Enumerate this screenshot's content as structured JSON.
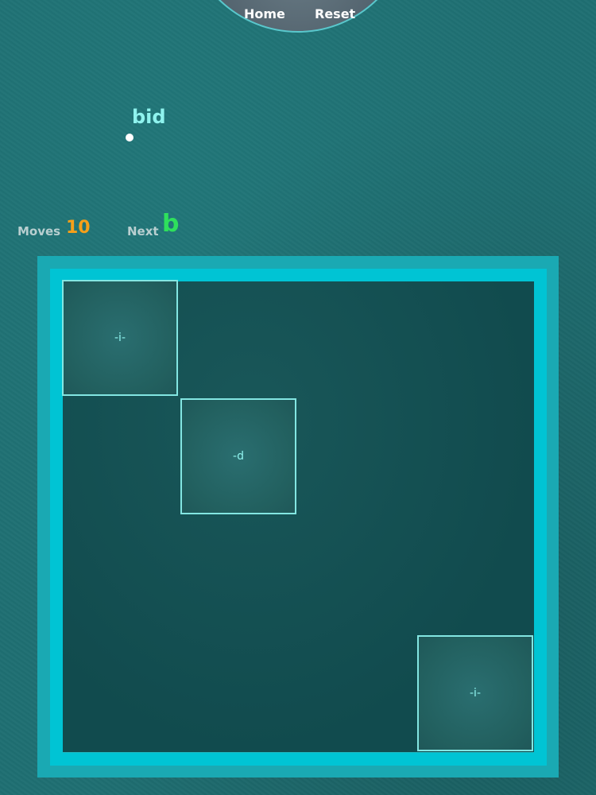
{
  "menu": {
    "home_label": "Home",
    "reset_label": "Reset"
  },
  "game": {
    "current_word": "bid",
    "moves_label": "Moves",
    "moves_value": "10",
    "next_label": "Next",
    "next_value": "b"
  },
  "board": {
    "tiles": [
      {
        "label": "-i-"
      },
      {
        "label": "-d"
      },
      {
        "label": "-i-"
      }
    ]
  },
  "colors": {
    "background": "#1f6f72",
    "board_frame": "#00c9da",
    "word": "#8ff3ee",
    "moves": "#f6a019",
    "next": "#2ee05c"
  }
}
